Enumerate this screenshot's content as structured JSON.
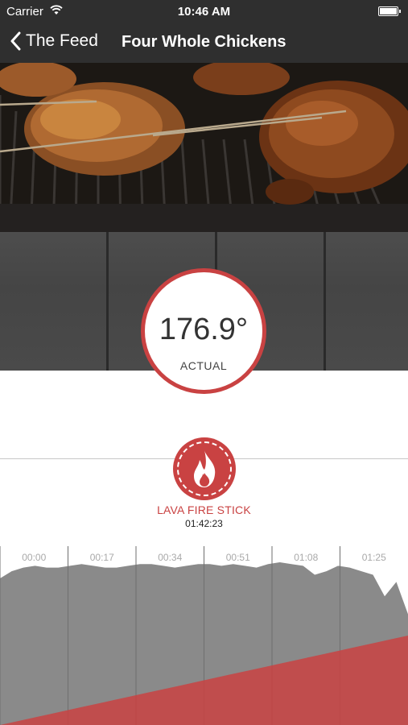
{
  "status_bar": {
    "carrier": "Carrier",
    "time": "10:46 AM"
  },
  "nav": {
    "back_label": "The Feed",
    "title": "Four Whole Chickens"
  },
  "temperature": {
    "value": "176.9°",
    "label": "ACTUAL"
  },
  "event": {
    "icon": "flame-icon",
    "name": "LAVA FIRE STICK",
    "time": "01:42:23"
  },
  "colors": {
    "accent": "#c94242",
    "bar": "#2f2f2f",
    "chart_fill": "#8a8a8a"
  },
  "chart_data": {
    "type": "area",
    "x_ticks": [
      "00:00",
      "00:17",
      "00:34",
      "00:51",
      "01:08",
      "01:25"
    ],
    "series": [
      {
        "values": [
          82,
          86,
          88,
          89,
          88,
          88,
          89,
          90,
          89,
          88,
          88,
          89,
          90,
          90,
          89,
          88,
          89,
          90,
          90,
          89,
          90,
          89,
          88,
          90,
          91,
          90,
          89,
          84,
          86,
          89,
          88,
          86,
          84,
          72,
          80,
          62
        ]
      },
      {
        "values": [
          0,
          2,
          4,
          6,
          8,
          10,
          12,
          14,
          16,
          18,
          20,
          22,
          24,
          26,
          28,
          30,
          32,
          34,
          36,
          38,
          40,
          42,
          44,
          46,
          48,
          50
        ]
      }
    ],
    "ylim": [
      0,
      100
    ],
    "grid": true
  }
}
